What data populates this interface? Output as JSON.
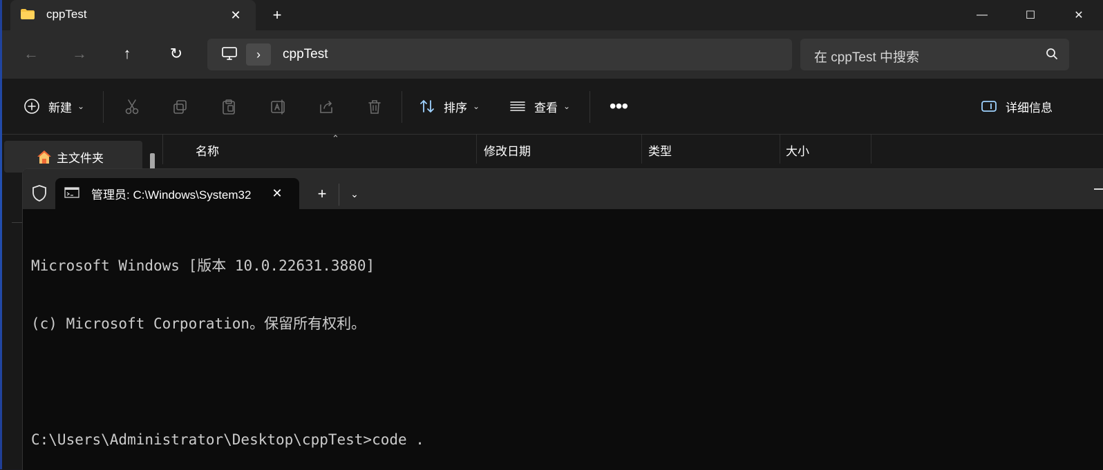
{
  "desktop": {
    "accent": "#2350b2"
  },
  "explorer": {
    "tab": {
      "title": "cppTest",
      "icon": "folder-icon",
      "close": "✕"
    },
    "new_tab": "+",
    "window_controls": {
      "minimize": "—",
      "maximize": "☐",
      "close": "✕"
    },
    "navigation": {
      "back": "←",
      "forward": "→",
      "up": "↑",
      "refresh": "↻",
      "path_separator": "›",
      "path": "cppTest"
    },
    "search": {
      "placeholder": "在 cppTest 中搜索"
    },
    "command_bar": {
      "new_label": "新建",
      "new_caret": "⌄",
      "sort_label": "排序",
      "sort_caret": "⌄",
      "view_label": "查看",
      "view_caret": "⌄",
      "more_label": "•••",
      "details_label": "详细信息"
    },
    "left_panel": {
      "home_label": "主文件夹"
    },
    "columns": {
      "sort_caret": "⌃",
      "name": "名称",
      "date": "修改日期",
      "type": "类型",
      "size": "大小"
    }
  },
  "terminal": {
    "tab": {
      "title": "管理员: C:\\Windows\\System32",
      "close": "✕"
    },
    "new_tab": "+",
    "dropdown": "⌄",
    "lines": [
      "Microsoft Windows [版本 10.0.22631.3880]",
      "(c) Microsoft Corporation。保留所有权利。",
      "",
      "C:\\Users\\Administrator\\Desktop\\cppTest>code ."
    ]
  }
}
